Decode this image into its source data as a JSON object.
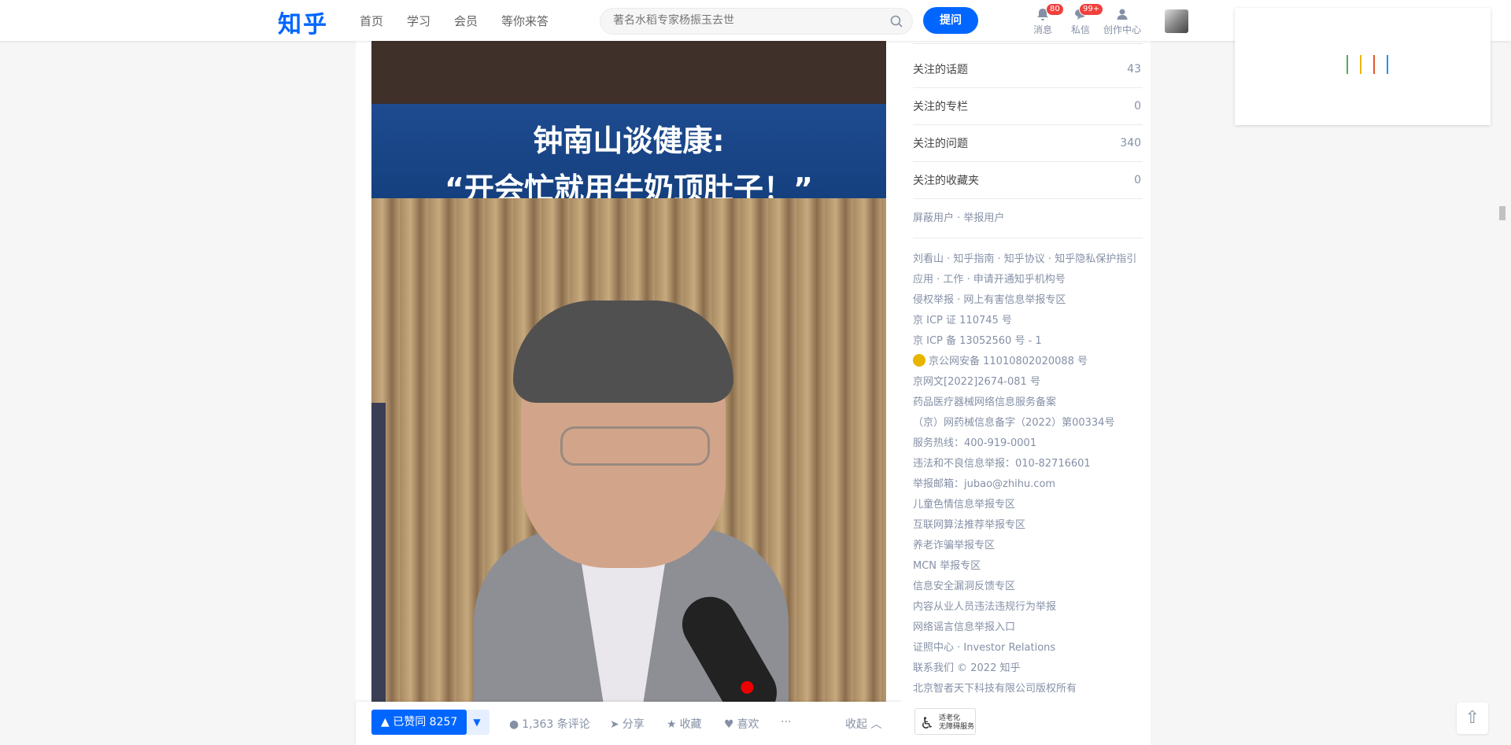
{
  "header": {
    "logo": "知乎",
    "nav": [
      "首页",
      "学习",
      "会员",
      "等你来答"
    ],
    "search_placeholder": "著名水稻专家杨振玉去世",
    "ask_label": "提问",
    "icons": [
      {
        "name": "bell-icon",
        "label": "消息",
        "badge": "80"
      },
      {
        "name": "message-icon",
        "label": "私信",
        "badge": "99+"
      },
      {
        "name": "creator-icon",
        "label": "创作中心",
        "badge": ""
      }
    ]
  },
  "video": {
    "title_line1": "钟南山谈健康:",
    "title_line2": "“开会忙就用牛奶顶肚子！”"
  },
  "actions": {
    "vote": "▲ 已赞同 8257",
    "vote_down": "▼",
    "comments": "1,363 条评论",
    "share": "分享",
    "favorite": "收藏",
    "like": "喜欢",
    "more": "···",
    "collapse": "收起"
  },
  "sidebar": {
    "rows": [
      {
        "label": "关注的话题",
        "count": "43"
      },
      {
        "label": "关注的专栏",
        "count": "0"
      },
      {
        "label": "关注的问题",
        "count": "340"
      },
      {
        "label": "关注的收藏夹",
        "count": "0"
      }
    ],
    "block_report": "屏蔽用户 · 举报用户",
    "footer": [
      "刘看山 · 知乎指南 · 知乎协议 · 知乎隐私保护指引",
      "应用 · 工作 · 申请开通知乎机构号",
      "侵权举报 · 网上有害信息举报专区",
      "京 ICP 证 110745 号",
      "京 ICP 备 13052560 号 - 1",
      "京公网安备 11010802020088 号",
      "京网文[2022]2674-081 号",
      "药品医疗器械网络信息服务备案",
      "（京）网药械信息备字（2022）第00334号",
      "服务热线：400-919-0001",
      "违法和不良信息举报：010-82716601",
      "举报邮箱：jubao@zhihu.com",
      "儿童色情信息举报专区",
      "互联网算法推荐举报专区",
      "养老诈骗举报专区",
      "MCN 举报专区",
      "信息安全漏洞反馈专区",
      "内容从业人员违法违规行为举报",
      "网络谣言信息举报入口",
      "证照中心 · Investor Relations",
      "联系我们 © 2022 知乎",
      "北京智者天下科技有限公司版权所有"
    ],
    "accessibility": [
      "适老化",
      "无障碍服务"
    ]
  },
  "colors": {
    "brand": "#0066ff",
    "loader": [
      "#4caf50",
      "#f4b400",
      "#e0562b",
      "#2196f3"
    ]
  }
}
